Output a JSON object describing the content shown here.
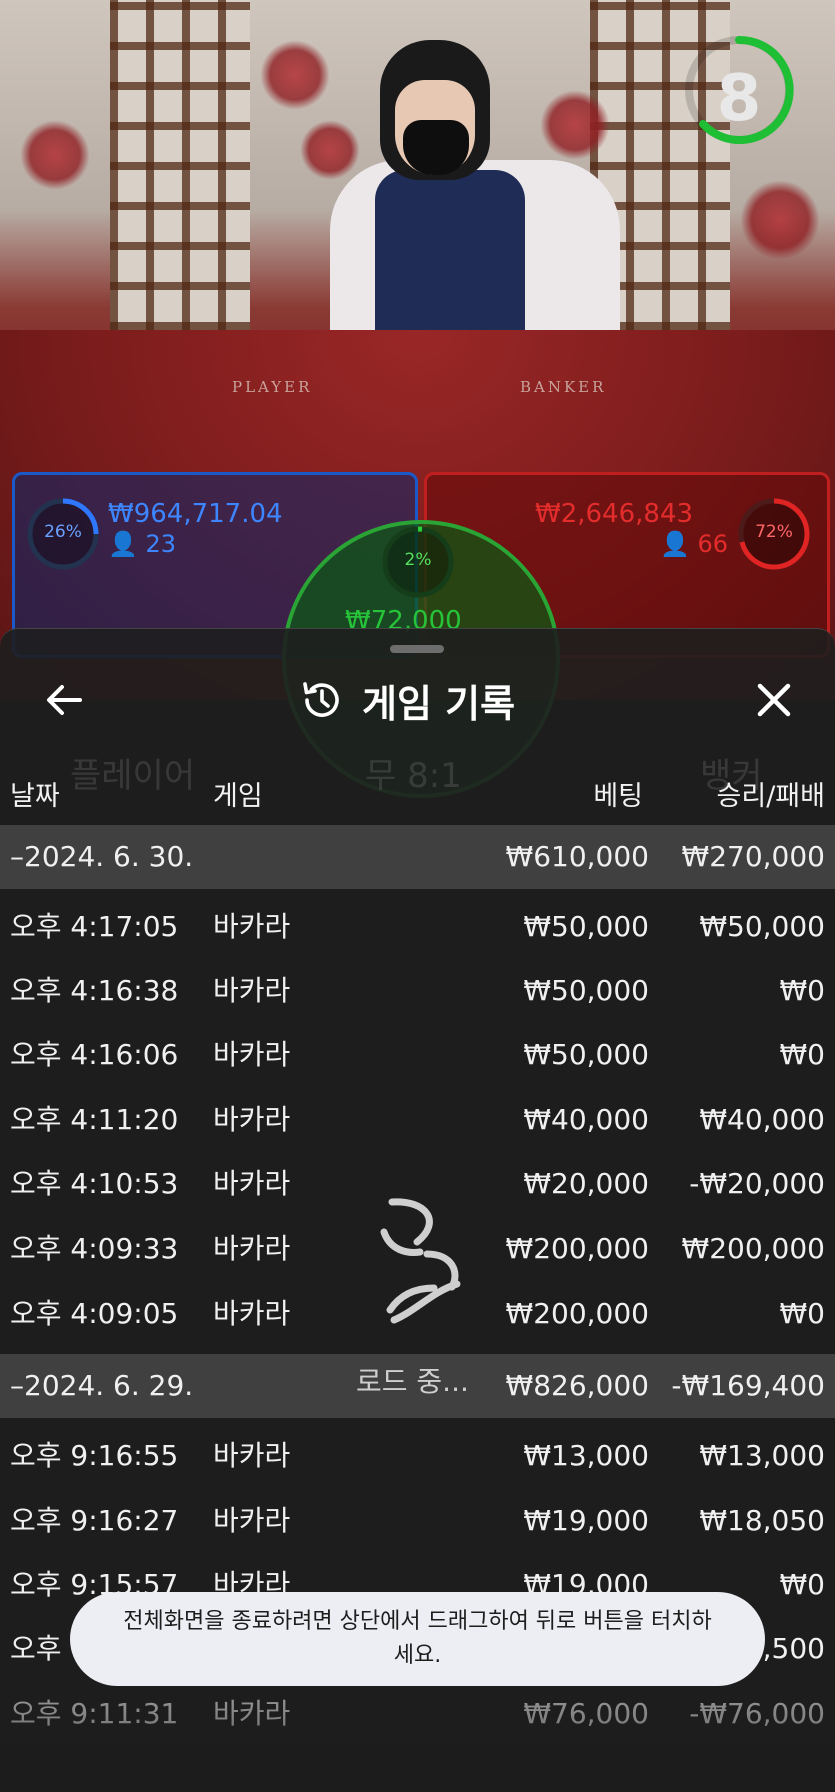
{
  "video": {
    "timer_value": "8",
    "table_labels": [
      "PLAYER",
      "BANKER"
    ]
  },
  "bets": {
    "player": {
      "percent": "26%",
      "amount": "₩964,717.04",
      "users": "23"
    },
    "banker": {
      "percent": "72%",
      "amount": "₩2,646,843",
      "users": "66"
    },
    "tie": {
      "percent": "2%",
      "amount": "₩72,000"
    }
  },
  "ghost_labels": [
    "플레이어",
    "무 8:1",
    "뱅커"
  ],
  "header": {
    "title": "게임 기록",
    "back_icon": "arrow-left-icon",
    "history_icon": "history-clock-icon",
    "close_icon": "close-icon"
  },
  "columns": {
    "date": "날짜",
    "game": "게임",
    "bet": "베팅",
    "winloss": "승리/패배"
  },
  "groups": [
    {
      "date": "–2024. 6. 30.",
      "total_bet": "₩610,000",
      "total_win": "₩270,000",
      "rows": [
        {
          "time": "오후 4:17:05",
          "game": "바카라",
          "bet": "₩50,000",
          "win": "₩50,000"
        },
        {
          "time": "오후 4:16:38",
          "game": "바카라",
          "bet": "₩50,000",
          "win": "₩0"
        },
        {
          "time": "오후 4:16:06",
          "game": "바카라",
          "bet": "₩50,000",
          "win": "₩0"
        },
        {
          "time": "오후 4:11:20",
          "game": "바카라",
          "bet": "₩40,000",
          "win": "₩40,000"
        },
        {
          "time": "오후 4:10:53",
          "game": "바카라",
          "bet": "₩20,000",
          "win": "-₩20,000"
        },
        {
          "time": "오후 4:09:33",
          "game": "바카라",
          "bet": "₩200,000",
          "win": "₩200,000"
        },
        {
          "time": "오후 4:09:05",
          "game": "바카라",
          "bet": "₩200,000",
          "win": "₩0"
        }
      ]
    },
    {
      "date": "–2024. 6. 29.",
      "total_bet": "₩826,000",
      "total_win": "-₩169,400",
      "rows": [
        {
          "time": "오후 9:16:55",
          "game": "바카라",
          "bet": "₩13,000",
          "win": "₩13,000"
        },
        {
          "time": "오후 9:16:27",
          "game": "바카라",
          "bet": "₩19,000",
          "win": "₩18,050"
        },
        {
          "time": "오후 9:15:57",
          "game": "바카라",
          "bet": "₩19,000",
          "win": "₩0"
        },
        {
          "time": "오후",
          "game": "",
          "bet": "",
          "win": ",500"
        },
        {
          "time": "오후 9:11:31",
          "game": "바카라",
          "bet": "₩76,000",
          "win": "-₩76,000"
        }
      ]
    }
  ],
  "loading": {
    "text": "로드 중...",
    "icon": "loading-spinner-icon"
  },
  "toast": {
    "text": "전체화면을 종료하려면 상단에서 드래그하여 뒤로 버튼을 터치하세요."
  },
  "colors": {
    "player_blue": "#1b58c8",
    "banker_red": "#c01f1f",
    "tie_green": "#2aa535",
    "timer_green": "#1fbf35"
  }
}
